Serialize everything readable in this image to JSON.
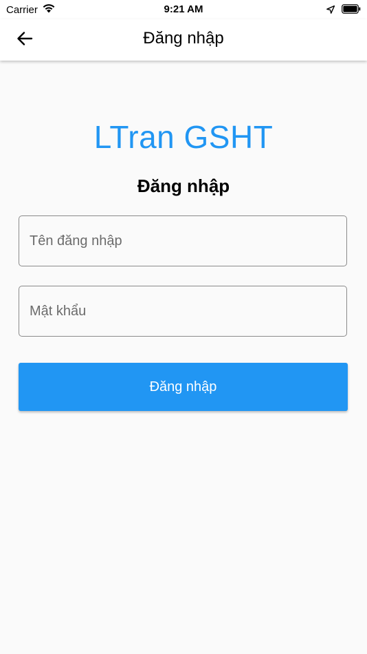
{
  "status_bar": {
    "carrier": "Carrier",
    "time": "9:21 AM",
    "icons": [
      "wifi-icon",
      "location-arrow-icon",
      "battery-icon"
    ]
  },
  "app_bar": {
    "back_icon": "arrow-left-icon",
    "title": "Đăng nhập"
  },
  "login": {
    "brand": "LTran GSHT",
    "heading": "Đăng nhập",
    "username": {
      "value": "",
      "placeholder": "Tên đăng nhập"
    },
    "password": {
      "value": "",
      "placeholder": "Mật khẩu"
    },
    "submit_label": "Đăng nhập"
  },
  "colors": {
    "accent": "#2196f3",
    "background": "#fafafa",
    "app_bar": "#ffffff",
    "field_border": "#8a8a8a"
  }
}
